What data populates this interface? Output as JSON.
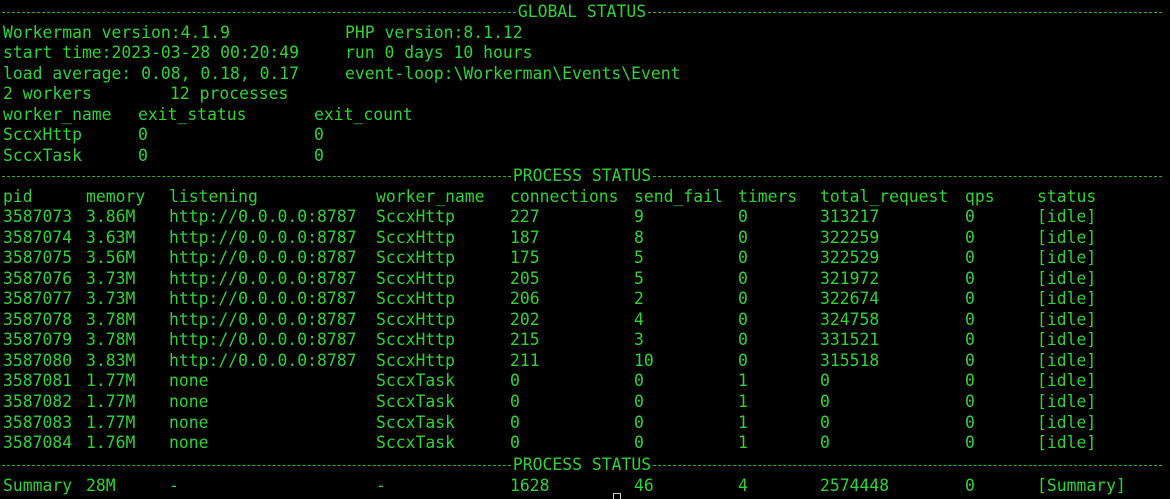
{
  "terminal": {
    "text_color": "#33d13a",
    "background": "#000000"
  },
  "global": {
    "header": "GLOBAL STATUS",
    "workerman_version": "Workerman version:4.1.9",
    "php_version": "PHP version:8.1.12",
    "start_time": "start time:2023-03-28 00:20:49",
    "run_time": "run 0 days 10 hours",
    "load_average": "load average: 0.08, 0.18, 0.17",
    "event_loop": "event-loop:\\Workerman\\Events\\Event",
    "workers": "2 workers",
    "processes": "12 processes",
    "worker_columns": [
      "worker_name",
      "exit_status",
      "exit_count"
    ],
    "workers_table": [
      [
        "SccxHttp",
        "0",
        "0"
      ],
      [
        "SccxTask",
        "0",
        "0"
      ]
    ]
  },
  "process": {
    "header": "PROCESS STATUS",
    "columns": [
      "pid",
      "memory",
      "listening",
      "worker_name",
      "connections",
      "send_fail",
      "timers",
      "total_request",
      "qps",
      "status"
    ],
    "rows": [
      [
        "3587073",
        "3.86M",
        "http://0.0.0.0:8787",
        "SccxHttp",
        "227",
        "9",
        "0",
        "313217",
        "0",
        "[idle]"
      ],
      [
        "3587074",
        "3.63M",
        "http://0.0.0.0:8787",
        "SccxHttp",
        "187",
        "8",
        "0",
        "322259",
        "0",
        "[idle]"
      ],
      [
        "3587075",
        "3.56M",
        "http://0.0.0.0:8787",
        "SccxHttp",
        "175",
        "5",
        "0",
        "322529",
        "0",
        "[idle]"
      ],
      [
        "3587076",
        "3.73M",
        "http://0.0.0.0:8787",
        "SccxHttp",
        "205",
        "5",
        "0",
        "321972",
        "0",
        "[idle]"
      ],
      [
        "3587077",
        "3.73M",
        "http://0.0.0.0:8787",
        "SccxHttp",
        "206",
        "2",
        "0",
        "322674",
        "0",
        "[idle]"
      ],
      [
        "3587078",
        "3.78M",
        "http://0.0.0.0:8787",
        "SccxHttp",
        "202",
        "4",
        "0",
        "324758",
        "0",
        "[idle]"
      ],
      [
        "3587079",
        "3.78M",
        "http://0.0.0.0:8787",
        "SccxHttp",
        "215",
        "3",
        "0",
        "331521",
        "0",
        "[idle]"
      ],
      [
        "3587080",
        "3.83M",
        "http://0.0.0.0:8787",
        "SccxHttp",
        "211",
        "10",
        "0",
        "315518",
        "0",
        "[idle]"
      ],
      [
        "3587081",
        "1.77M",
        "none",
        "SccxTask",
        "0",
        "0",
        "1",
        "0",
        "0",
        "[idle]"
      ],
      [
        "3587082",
        "1.77M",
        "none",
        "SccxTask",
        "0",
        "0",
        "1",
        "0",
        "0",
        "[idle]"
      ],
      [
        "3587083",
        "1.77M",
        "none",
        "SccxTask",
        "0",
        "0",
        "1",
        "0",
        "0",
        "[idle]"
      ],
      [
        "3587084",
        "1.76M",
        "none",
        "SccxTask",
        "0",
        "0",
        "1",
        "0",
        "0",
        "[idle]"
      ]
    ],
    "footer_header": "PROCESS STATUS",
    "summary": [
      "Summary",
      "28M",
      "-",
      "-",
      "1628",
      "46",
      "4",
      "2574448",
      "0",
      "[Summary]"
    ]
  }
}
